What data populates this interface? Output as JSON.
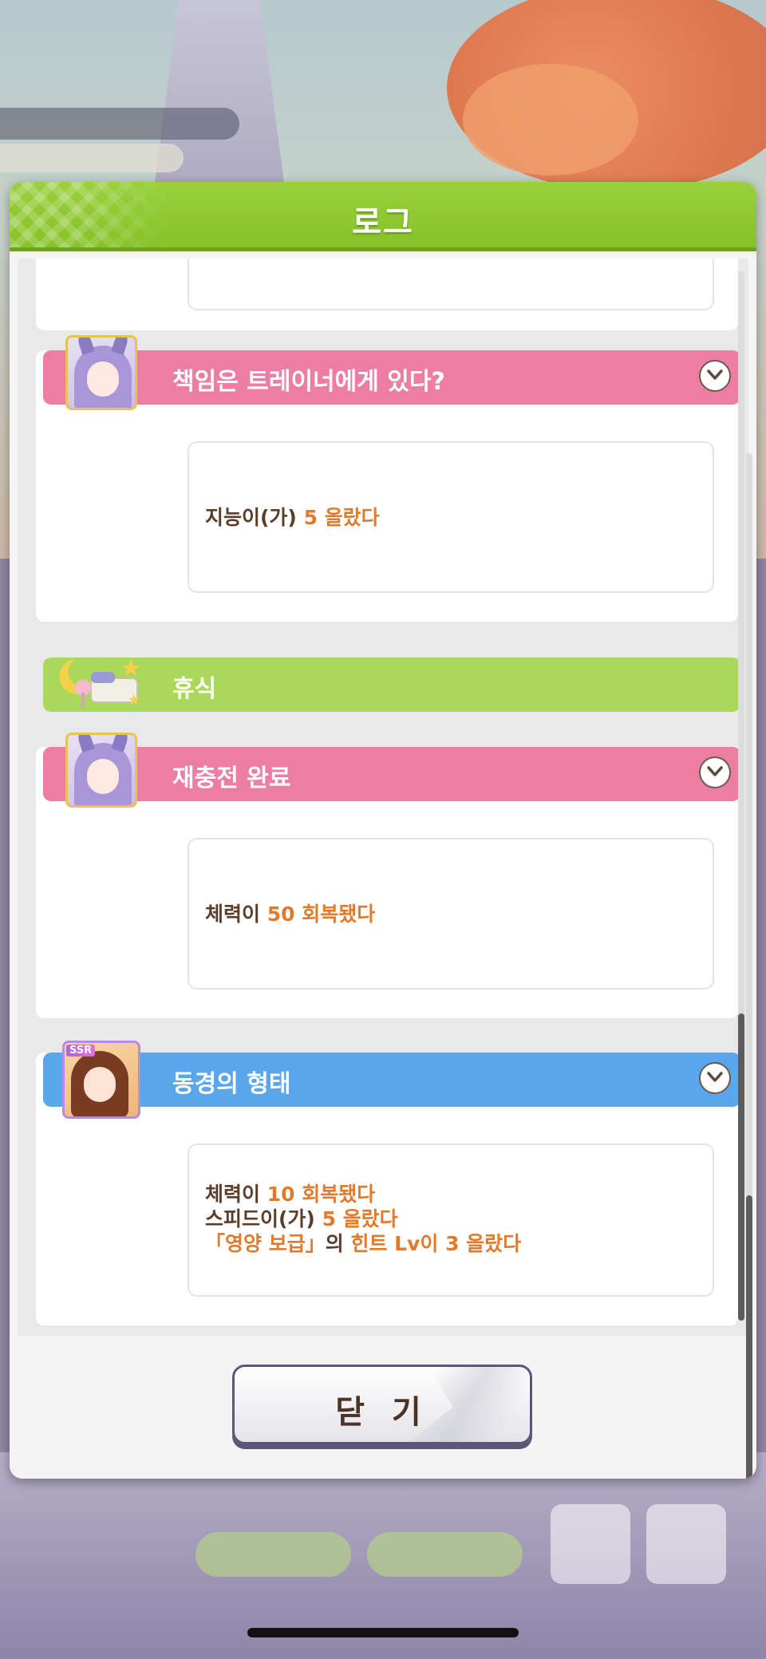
{
  "dialog": {
    "title": "로그",
    "close_label": "닫 기"
  },
  "entries": [
    {
      "title": "책임은 트레이너에게 있다?",
      "color": "#ec7ea3",
      "lines": [
        {
          "parts": [
            "지능이(가) ",
            "5 올랐다"
          ]
        }
      ]
    },
    {
      "title": "휴식",
      "color": "#a9d85a"
    },
    {
      "title": "재충전 완료",
      "color": "#ec7ea3",
      "lines": [
        {
          "parts": [
            "체력이 ",
            "50 회복됐다"
          ]
        }
      ]
    },
    {
      "title": "동경의 형태",
      "color": "#59a6ec",
      "badge": "SSR",
      "lines": [
        {
          "parts": [
            "체력이 ",
            "10 회복됐다"
          ]
        },
        {
          "parts": [
            "스피드이(가) ",
            "5 올랐다"
          ]
        },
        {
          "parts": [
            "「영양 보급」",
            "의 ",
            "힌트 Lv이 3 올랐다"
          ]
        }
      ]
    }
  ],
  "colors": {
    "header_green": "#8cc630",
    "highlight_orange": "#e27a2c",
    "text_brown": "#5a3d2b"
  }
}
